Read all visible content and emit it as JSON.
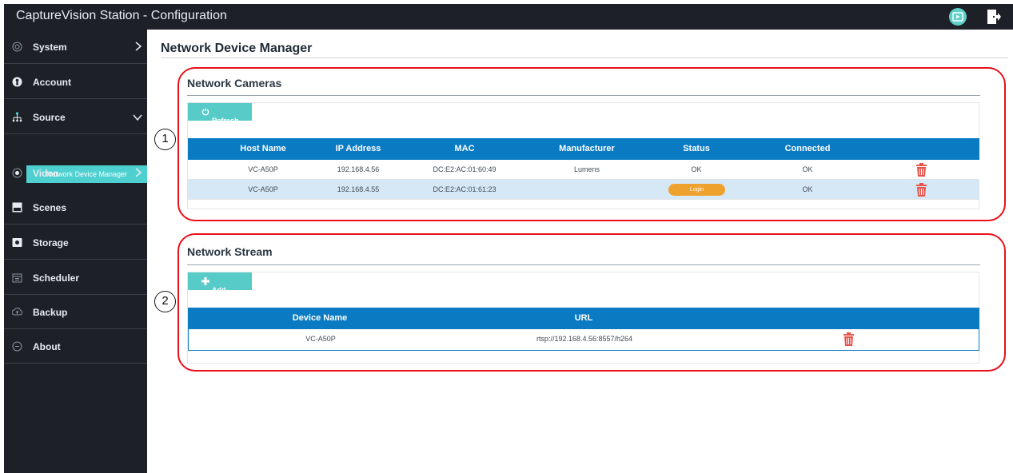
{
  "app": {
    "title": "CaptureVision Station - Configuration",
    "colors": {
      "sidebar": "#1d2127",
      "accent": "#4ed0d0",
      "table_header": "#0a7bc3",
      "login": "#efa12d",
      "delete": "#e5534b",
      "callout": "#e8101a"
    }
  },
  "sidebar": {
    "items": [
      {
        "label": "System",
        "icon": "gear-icon"
      },
      {
        "label": "Account",
        "icon": "user-icon"
      },
      {
        "label": "Source",
        "icon": "network-tree-icon"
      },
      {
        "label": "Video",
        "icon": "radio-dot-icon"
      },
      {
        "label": "Scenes",
        "icon": "scenes-icon"
      },
      {
        "label": "Storage",
        "icon": "storage-icon"
      },
      {
        "label": "Scheduler",
        "icon": "calendar-icon"
      },
      {
        "label": "Backup",
        "icon": "backup-icon"
      },
      {
        "label": "About",
        "icon": "info-icon"
      }
    ],
    "sub_item": "Network Device Manager"
  },
  "page": {
    "title": "Network Device Manager"
  },
  "cameras": {
    "title": "Network Cameras",
    "refresh_label": "Refresh",
    "columns": [
      "Host Name",
      "IP Address",
      "MAC",
      "Manufacturer",
      "Status",
      "Connected"
    ],
    "rows": [
      {
        "host": "VC-A50P",
        "ip": "192.168.4.56",
        "mac": "DC:E2:AC:01:60:49",
        "manufacturer": "Lumens",
        "status": "OK",
        "connected": "OK"
      },
      {
        "host": "VC-A50P",
        "ip": "192.168.4.55",
        "mac": "DC:E2:AC:01:61:23",
        "manufacturer": "",
        "status": "Login",
        "connected": "OK"
      }
    ]
  },
  "streams": {
    "title": "Network Stream",
    "add_label": "Add",
    "columns": [
      "Device Name",
      "URL"
    ],
    "rows": [
      {
        "device": "VC-A50P",
        "url": "rtsp://192.168.4.56:8557/h264"
      }
    ]
  },
  "callouts": [
    "1",
    "2"
  ]
}
